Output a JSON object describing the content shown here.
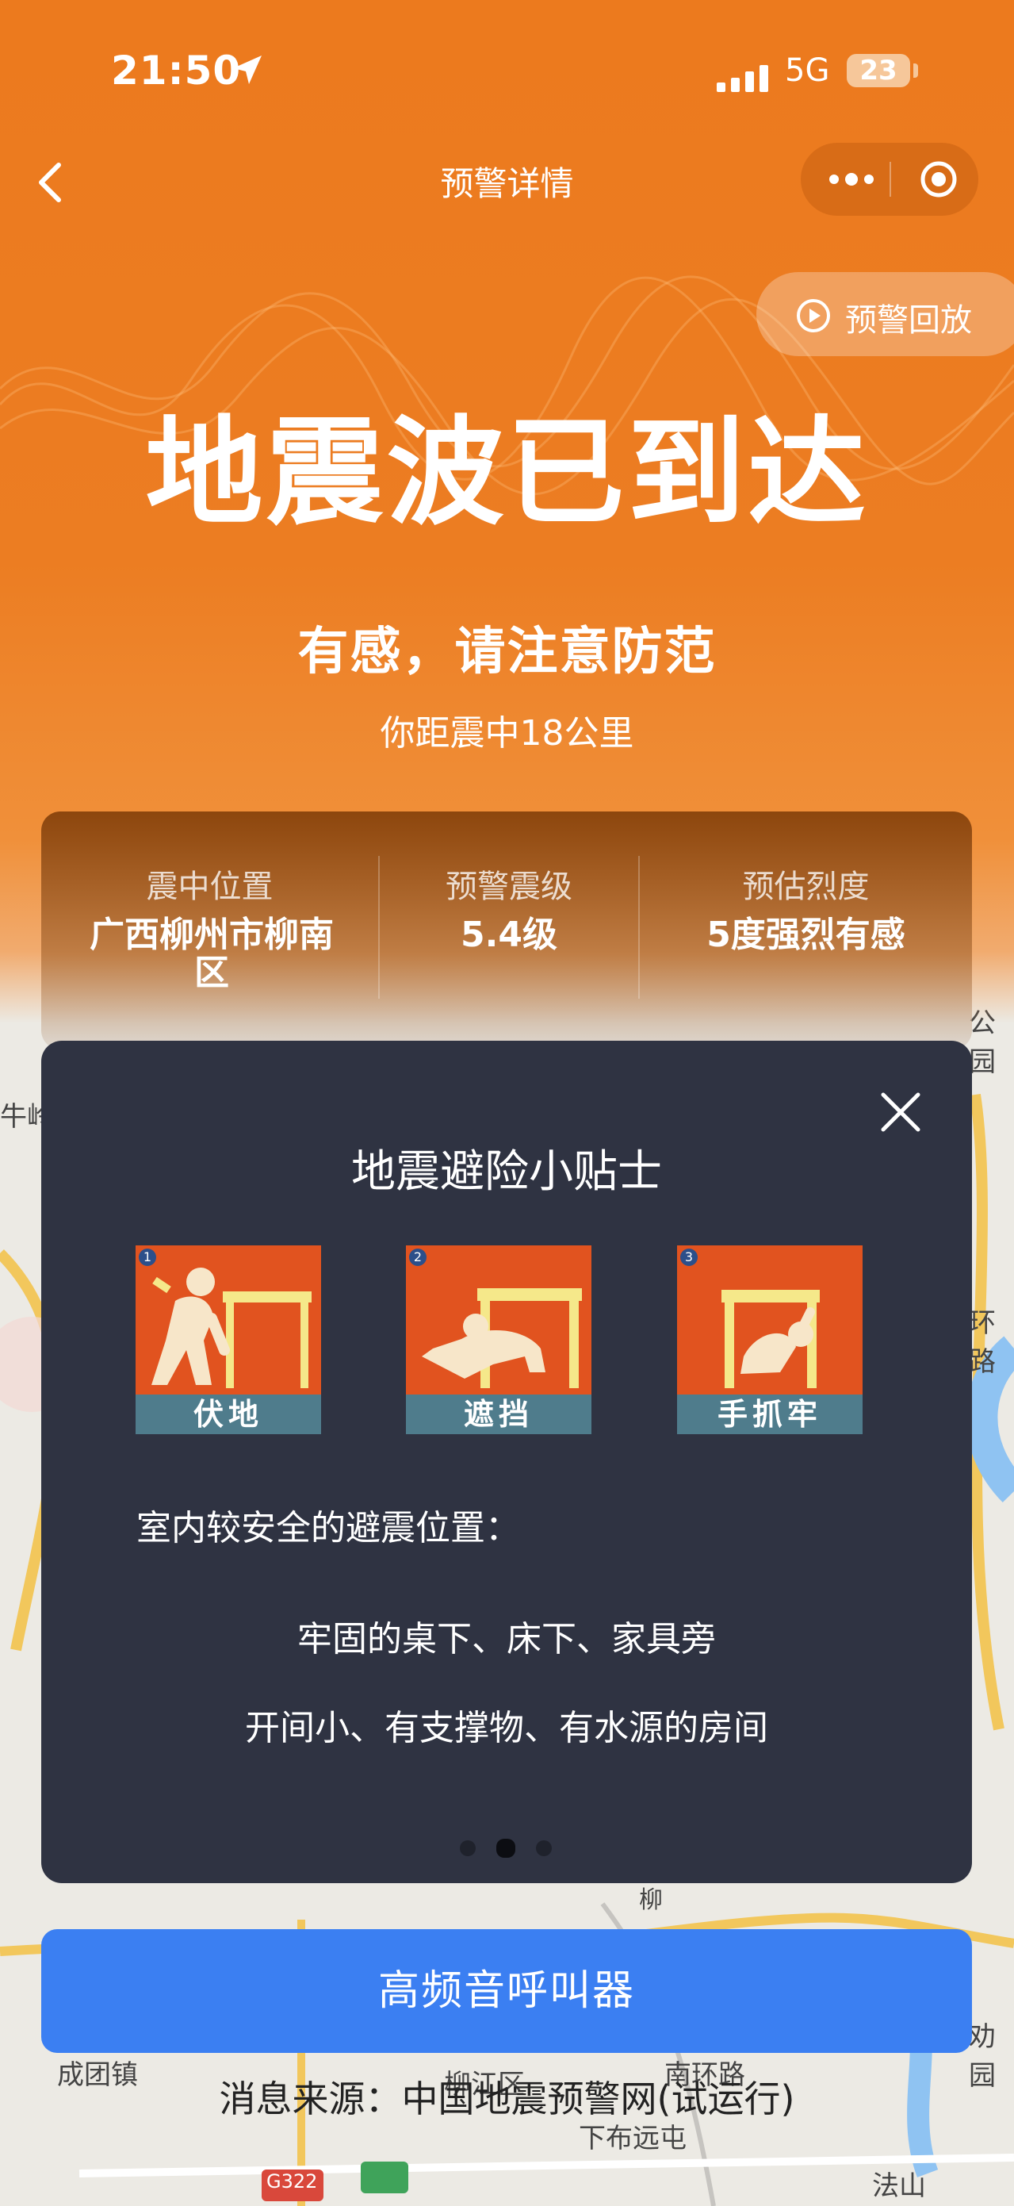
{
  "status_bar": {
    "time": "21:50",
    "network": "5G",
    "battery": "23"
  },
  "nav": {
    "title": "预警详情"
  },
  "replay": {
    "label": "预警回放"
  },
  "hero": {
    "headline": "地震波已到达",
    "subline": "有感，请注意防范",
    "distance": "你距震中18公里"
  },
  "info": {
    "epicenter_label": "震中位置",
    "epicenter_value": "广西柳州市柳南区",
    "magnitude_label": "预警震级",
    "magnitude_value": "5.4级",
    "intensity_label": "预估烈度",
    "intensity_value": "5度强烈有感"
  },
  "tips": {
    "title": "地震避险小贴士",
    "pictures": [
      {
        "number": "1",
        "caption": "伏地"
      },
      {
        "number": "2",
        "caption": "遮挡"
      },
      {
        "number": "3",
        "caption": "手抓牢"
      }
    ],
    "subtitle": "室内较安全的避震位置：",
    "line1": "牢固的桌下、床下、家具旁",
    "line2": "开间小、有支撑物、有水源的房间",
    "active_page": 2,
    "page_count": 3
  },
  "cta": {
    "label": "高频音呼叫器"
  },
  "source": {
    "text": "消息来源：中国地震预警网(试运行)"
  },
  "map_labels": {
    "park_top": "公园",
    "ling": "牛岭",
    "ring_road": "环路",
    "tuan": "成团镇",
    "liujiang": "柳江区",
    "south_ring": "南环路",
    "xiabu": "下布远屯",
    "fashan": "法山",
    "g322": "G322",
    "park_bottom": "劝园",
    "liu": "柳"
  },
  "colors": {
    "hero_orange": "#ec7a1e",
    "panel_dark": "#2f3342",
    "cta_blue": "#3b7ff2"
  }
}
